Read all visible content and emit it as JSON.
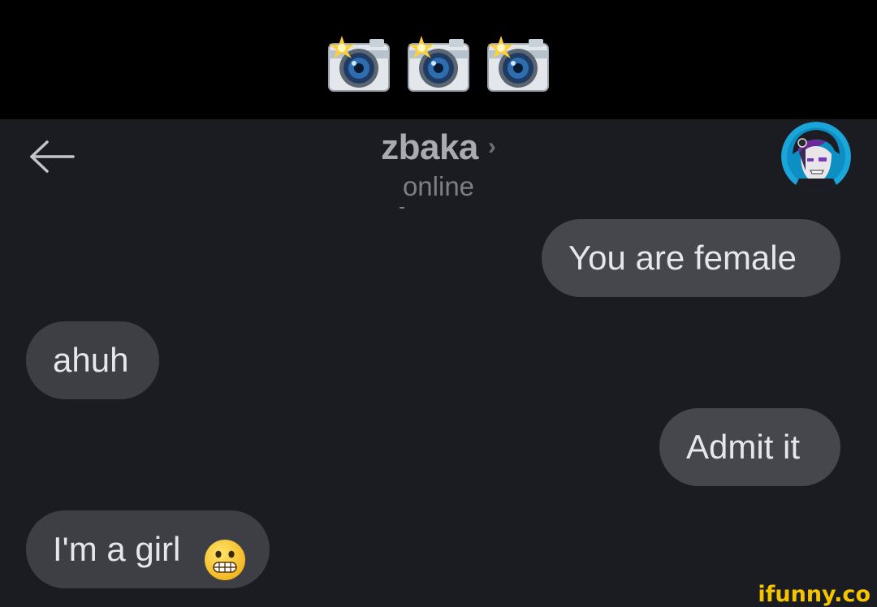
{
  "caption": {
    "icons": [
      "camera-flash-icon",
      "camera-flash-icon",
      "camera-flash-icon"
    ]
  },
  "header": {
    "back_icon": "back-arrow-icon",
    "contact_name": "zbaka",
    "chevron": "›",
    "status": "online",
    "avatar_icon": "avatar-icon"
  },
  "messages": [
    {
      "direction": "outgoing",
      "text": "You are female"
    },
    {
      "direction": "incoming",
      "text": "ahuh"
    },
    {
      "direction": "outgoing",
      "text": "Admit it"
    },
    {
      "direction": "incoming",
      "text": "I'm a girl",
      "emoji": "grimacing-face-icon"
    }
  ],
  "watermark": {
    "text": "ifunny.co"
  },
  "colors": {
    "background": "#1b1c21",
    "caption_band": "#000000",
    "bubble": "#3d3f45",
    "text": "#e6e7ea",
    "name": "#a9abb1",
    "watermark": "#f5c400"
  }
}
